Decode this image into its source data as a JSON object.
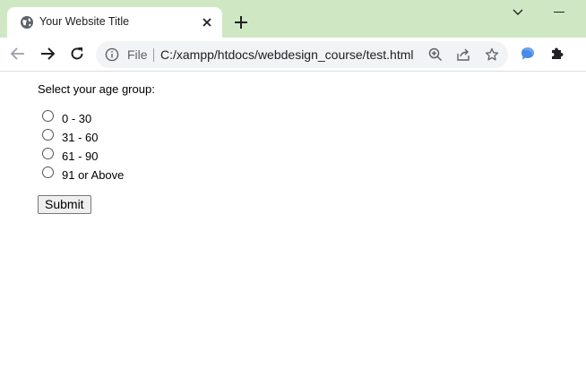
{
  "browser": {
    "tab": {
      "title": "Your Website Title",
      "favicon": "globe-icon"
    },
    "toolbar": {
      "address_scheme_label": "File",
      "address_url": "C:/xampp/htdocs/webdesign_course/test.html"
    }
  },
  "form": {
    "question": "Select your age group:",
    "options": [
      {
        "label": "0 - 30",
        "checked": false
      },
      {
        "label": "31 - 60",
        "checked": false
      },
      {
        "label": "61 - 90",
        "checked": false
      },
      {
        "label": "91 or Above",
        "checked": false
      }
    ],
    "submit_label": "Submit"
  }
}
